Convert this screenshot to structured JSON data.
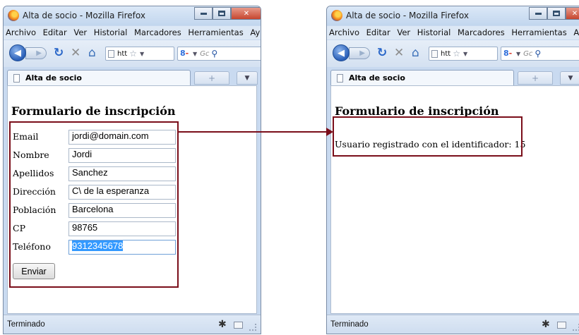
{
  "left_window": {
    "title": "Alta de socio - Mozilla Firefox",
    "menu": [
      "Archivo",
      "Editar",
      "Ver",
      "Historial",
      "Marcadores",
      "Herramientas",
      "Ay"
    ],
    "url": "htt",
    "search_placeholder": "Gc",
    "tab_label": "Alta de socio",
    "page_title": "Formulario de inscripción",
    "form": {
      "email_label": "Email",
      "email_value": "jordi@domain.com",
      "nombre_label": "Nombre",
      "nombre_value": "Jordi",
      "apellidos_label": "Apellidos",
      "apellidos_value": "Sanchez",
      "direccion_label": "Dirección",
      "direccion_value": "C\\ de la esperanza",
      "poblacion_label": "Población",
      "poblacion_value": "Barcelona",
      "cp_label": "CP",
      "cp_value": "98765",
      "telefono_label": "Teléfono",
      "telefono_value": "9312345678",
      "submit_label": "Enviar"
    },
    "status": "Terminado"
  },
  "right_window": {
    "title": "Alta de socio - Mozilla Firefox",
    "menu": [
      "Archivo",
      "Editar",
      "Ver",
      "Historial",
      "Marcadores",
      "Herramientas",
      "Ay"
    ],
    "url": "htt",
    "search_placeholder": "Gc",
    "tab_label": "Alta de socio",
    "page_title": "Formulario de inscripción",
    "result_text": "Usuario registrado con el identificador: 15",
    "status": "Terminado"
  },
  "colors": {
    "highlight": "#7a0e1a",
    "selection": "#3399ff",
    "window_frame": "#c9daf0"
  },
  "icons": [
    "firefox-logo-icon",
    "back-icon",
    "forward-icon",
    "reload-icon",
    "stop-icon",
    "home-icon",
    "bookmark-star-icon",
    "search-engine-icon",
    "search-icon",
    "new-tab-icon",
    "tab-list-icon",
    "addon-bug-icon",
    "mail-icon"
  ]
}
